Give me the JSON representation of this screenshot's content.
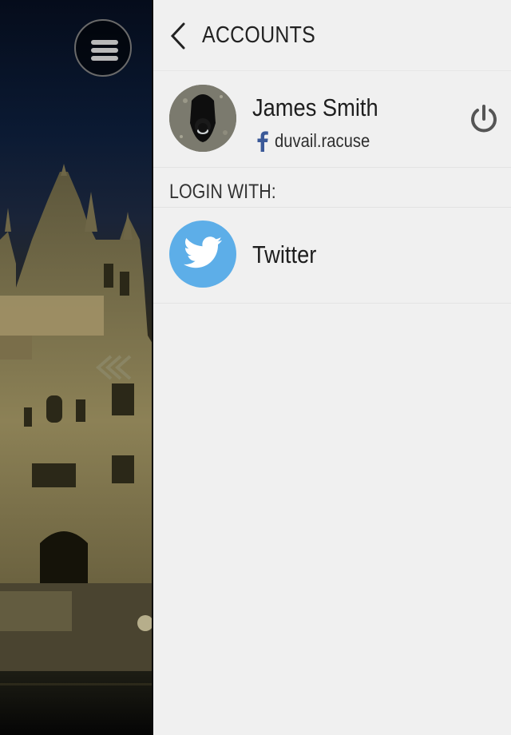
{
  "header": {
    "title": "ACCOUNTS"
  },
  "account": {
    "name": "James Smith",
    "handle": "duvail.racuse",
    "provider_icon": "facebook-icon"
  },
  "login_section": {
    "label": "LOGIN WITH:",
    "providers": [
      {
        "label": "Twitter",
        "icon": "twitter-bird-icon"
      }
    ]
  },
  "colors": {
    "twitter": "#5daee8",
    "facebook": "#3b5998",
    "panel_bg": "#f0f0f0"
  }
}
